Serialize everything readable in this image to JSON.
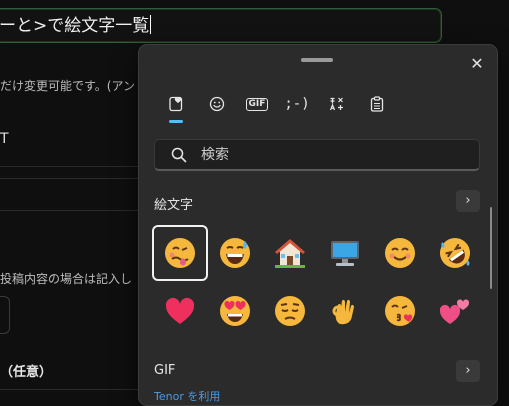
{
  "background": {
    "input_text": "ーと>で絵文字一覧",
    "note": "だけ変更可能です。(アン",
    "field_value": "T",
    "note2": "投稿内容の場合は記入し",
    "optional_label": "（任意）"
  },
  "panel": {
    "close_icon": "✕",
    "tabs": [
      {
        "name": "recent-emoji-tab",
        "label": ""
      },
      {
        "name": "emoji-tab",
        "label": ""
      },
      {
        "name": "gif-tab",
        "label": "GIF"
      },
      {
        "name": "kaomoji-tab",
        "label": ";-)"
      },
      {
        "name": "symbols-tab",
        "label": ""
      },
      {
        "name": "clipboard-tab",
        "label": ""
      }
    ],
    "search_placeholder": "検索",
    "emoji_section_title": "絵文字",
    "gif_section_title": "GIF",
    "section_arrow": "›",
    "tenor_text": "Tenor を利用",
    "accent": "#4cc2ff"
  }
}
